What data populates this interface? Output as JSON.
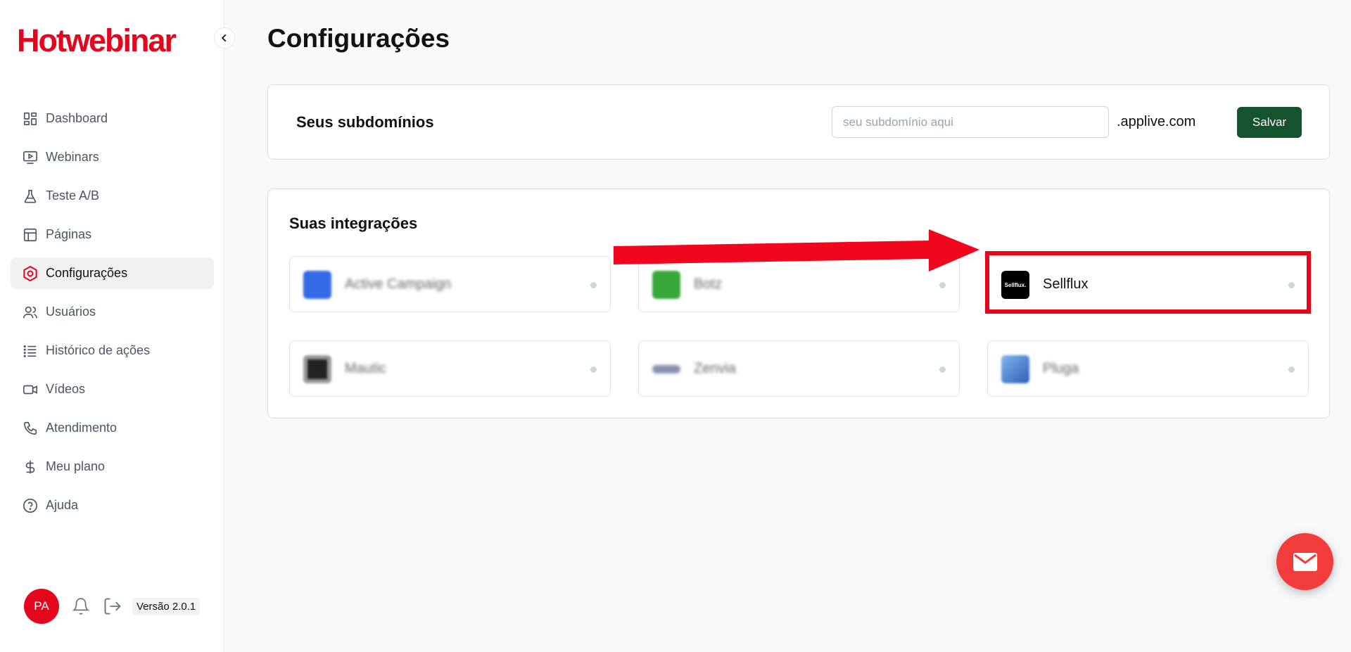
{
  "brand": {
    "logo": "Hotwebinar",
    "accent": "#e4061d"
  },
  "page": {
    "title": "Configurações"
  },
  "sidebar": {
    "items": [
      {
        "label": "Dashboard",
        "icon": "dashboard-grid-icon"
      },
      {
        "label": "Webinars",
        "icon": "play-monitor-icon"
      },
      {
        "label": "Teste A/B",
        "icon": "flask-icon"
      },
      {
        "label": "Páginas",
        "icon": "layout-icon"
      },
      {
        "label": "Configurações",
        "icon": "gear-icon",
        "active": true
      },
      {
        "label": "Usuários",
        "icon": "users-icon"
      },
      {
        "label": "Histórico de ações",
        "icon": "list-icon"
      },
      {
        "label": "Vídeos",
        "icon": "video-camera-icon"
      },
      {
        "label": "Atendimento",
        "icon": "phone-icon"
      },
      {
        "label": "Meu plano",
        "icon": "dollar-icon"
      },
      {
        "label": "Ajuda",
        "icon": "help-circle-icon"
      }
    ],
    "footer": {
      "avatar_initials": "PA",
      "version": "Versão 2.0.1"
    }
  },
  "subdomains": {
    "title": "Seus subdomínios",
    "input_placeholder": "seu subdomínio aqui",
    "input_value": "",
    "suffix": ".applive.com",
    "save_label": "Salvar"
  },
  "integrations": {
    "title": "Suas integrações",
    "items": [
      {
        "name": "Active Campaign",
        "blurred": true,
        "logo_color": "#356ae6"
      },
      {
        "name": "Botz",
        "blurred": true,
        "logo_color": "#39a83a"
      },
      {
        "name": "Sellflux",
        "blurred": false,
        "logo_color": "#000000",
        "logo_text": "Sellflux."
      },
      {
        "name": "Mautic",
        "blurred": true,
        "logo_color": "#222222"
      },
      {
        "name": "Zenvia",
        "blurred": true,
        "logo_color": "#8a8fb0"
      },
      {
        "name": "Pluga",
        "blurred": true,
        "logo_color": "#2f5db8"
      }
    ]
  },
  "colors": {
    "save_button": "#14532d",
    "fab": "#f23b3b",
    "highlight": "#e4061d"
  }
}
